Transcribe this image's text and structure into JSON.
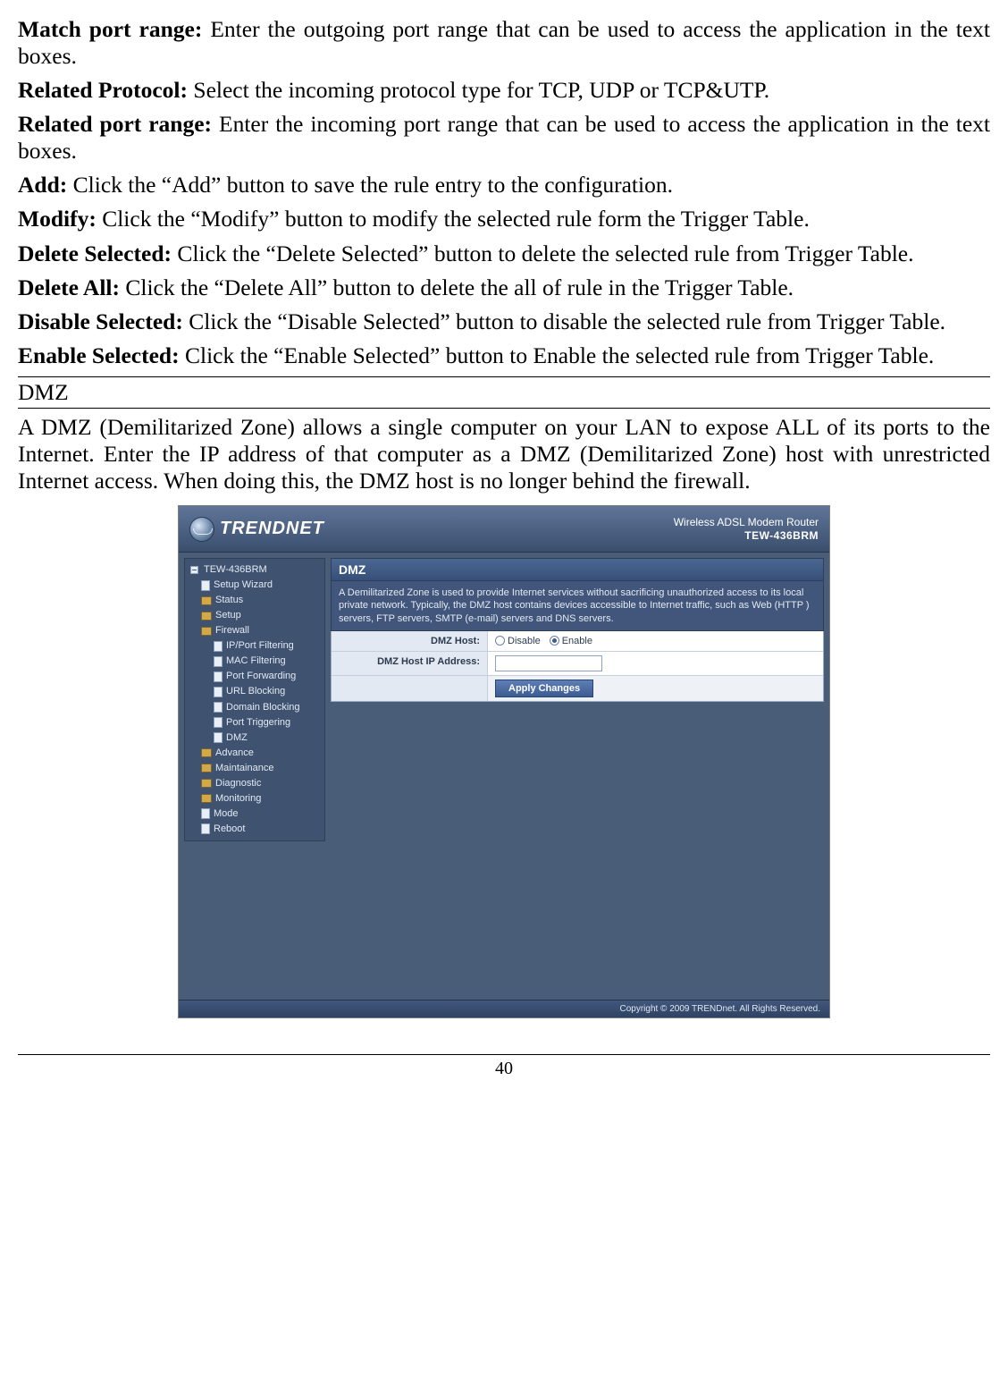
{
  "definitions": [
    {
      "term": "Match port range:",
      "desc": "Enter the outgoing port range that can be used to access the application in the text boxes."
    },
    {
      "term": "Related Protocol:",
      "desc": "Select the incoming protocol type for TCP, UDP or TCP&UTP."
    },
    {
      "term": "Related port range:",
      "desc": "Enter the incoming port range that can be used to access the application in the text boxes."
    },
    {
      "term": "Add:",
      "desc": "Click the “Add” button to save the rule entry to the configuration."
    },
    {
      "term": "Modify:",
      "desc": "Click the “Modify” button to modify the selected rule form the Trigger Table."
    },
    {
      "term": "Delete Selected:",
      "desc": "Click the “Delete Selected” button to delete the selected rule from Trigger Table."
    },
    {
      "term": "Delete All:",
      "desc": "Click the “Delete All” button to delete the all of rule in the Trigger Table."
    },
    {
      "term": "Disable Selected:",
      "desc": "Click the “Disable Selected” button to disable the selected rule from Trigger Table."
    },
    {
      "term": "Enable Selected:",
      "desc": "Click the “Enable Selected” button to Enable the selected rule from Trigger Table."
    }
  ],
  "section_heading": "DMZ",
  "dmz_paragraph": "A DMZ (Demilitarized Zone) allows a single computer on your LAN to expose ALL of its ports to the Internet. Enter the IP address of that computer as a DMZ (Demilitarized Zone) host with unrestricted Internet access. When doing this, the DMZ host is no longer behind the firewall.",
  "router_ui": {
    "brand": "TRENDNET",
    "product": "Wireless ADSL Modem Router",
    "model": "TEW-436BRM",
    "nav": {
      "root": "TEW-436BRM",
      "items": [
        "Setup Wizard",
        "Status",
        "Setup"
      ],
      "firewall_label": "Firewall",
      "firewall_children": [
        "IP/Port Filtering",
        "MAC Filtering",
        "Port Forwarding",
        "URL Blocking",
        "Domain Blocking",
        "Port Triggering",
        "DMZ"
      ],
      "tail_items": [
        "Advance",
        "Maintainance",
        "Diagnostic",
        "Monitoring",
        "Mode",
        "Reboot"
      ]
    },
    "panel": {
      "title": "DMZ",
      "desc": "A Demilitarized Zone is used to provide Internet services without sacrificing unauthorized access to its local private network. Typically, the DMZ host contains devices accessible to Internet traffic, such as Web (HTTP ) servers, FTP servers, SMTP (e-mail) servers and DNS servers.",
      "row1_label": "DMZ Host:",
      "disable_label": "Disable",
      "enable_label": "Enable",
      "row2_label": "DMZ Host IP Address:",
      "apply": "Apply Changes"
    },
    "footer": "Copyright © 2009 TRENDnet. All Rights Reserved."
  },
  "page_number": "40"
}
